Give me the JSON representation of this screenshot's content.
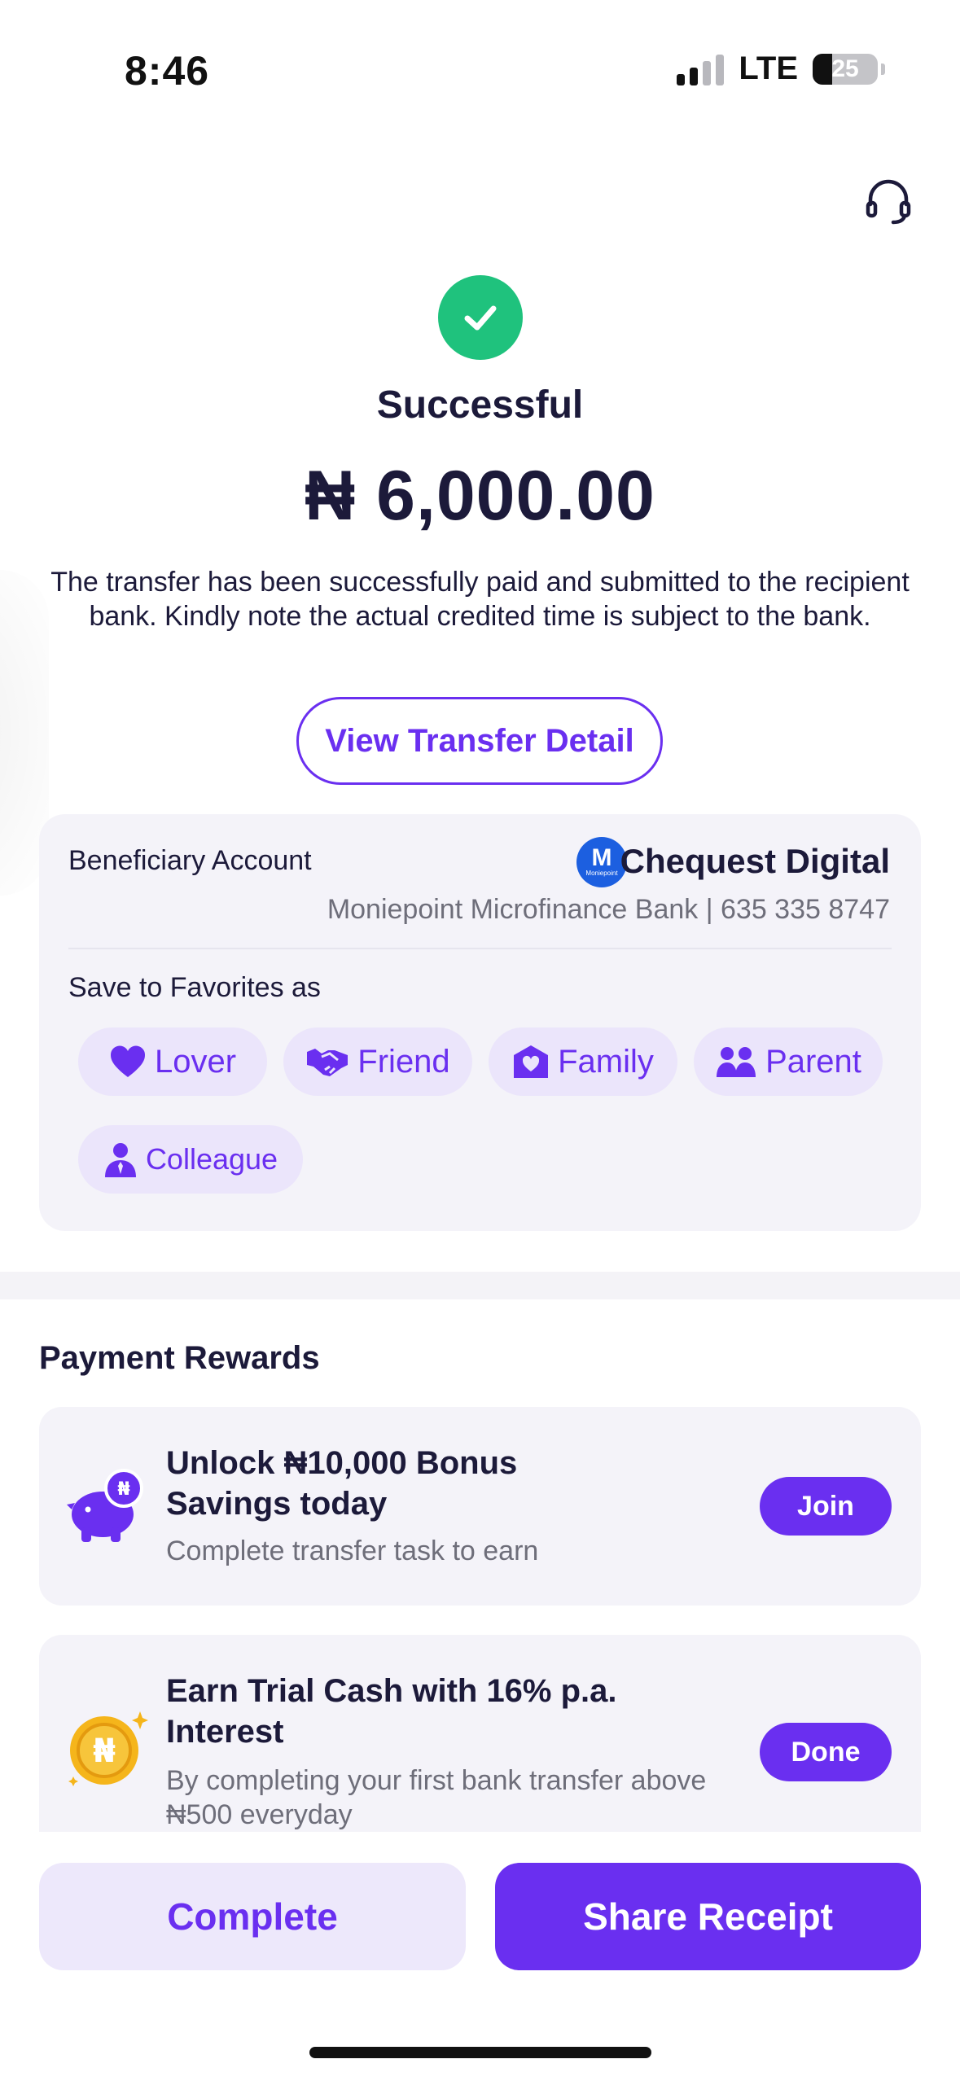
{
  "status_bar": {
    "time": "8:46",
    "network": "LTE",
    "battery": "25"
  },
  "result": {
    "status": "Successful",
    "amount": "₦ 6,000.00",
    "message": "The transfer has been successfully paid and submitted to the recipient bank. Kindly note the actual credited time is subject to the bank.",
    "view_detail_label": "View Transfer Detail"
  },
  "beneficiary": {
    "label": "Beneficiary Account",
    "bank_logo_letter": "M",
    "bank_logo_text": "Moniepoint",
    "name": "Chequest Digital",
    "bank_details": "Moniepoint Microfinance Bank | 635 335 8747"
  },
  "favorites": {
    "label": "Save to Favorites as",
    "options": [
      {
        "label": "Lover",
        "icon": "heart-icon"
      },
      {
        "label": "Friend",
        "icon": "handshake-icon"
      },
      {
        "label": "Family",
        "icon": "home-heart-icon"
      },
      {
        "label": "Parent",
        "icon": "parents-icon"
      },
      {
        "label": "Colleague",
        "icon": "person-tie-icon"
      }
    ]
  },
  "rewards": {
    "title": "Payment Rewards",
    "items": [
      {
        "title": "Unlock ₦10,000 Bonus Savings today",
        "subtitle": "Complete transfer task to earn",
        "button": "Join",
        "icon": "piggy-bank-icon"
      },
      {
        "title": "Earn Trial Cash with 16% p.a. Interest",
        "subtitle": "By completing your first bank transfer above ₦500 everyday",
        "button": "Done",
        "icon": "naira-coin-icon",
        "coin_symbol": "₦"
      }
    ]
  },
  "actions": {
    "complete_label": "Complete",
    "share_label": "Share Receipt"
  },
  "colors": {
    "accent": "#6a2ff0",
    "success": "#1fc27d",
    "card_bg": "#f4f3f9",
    "chip_bg": "#ebe5fb"
  }
}
